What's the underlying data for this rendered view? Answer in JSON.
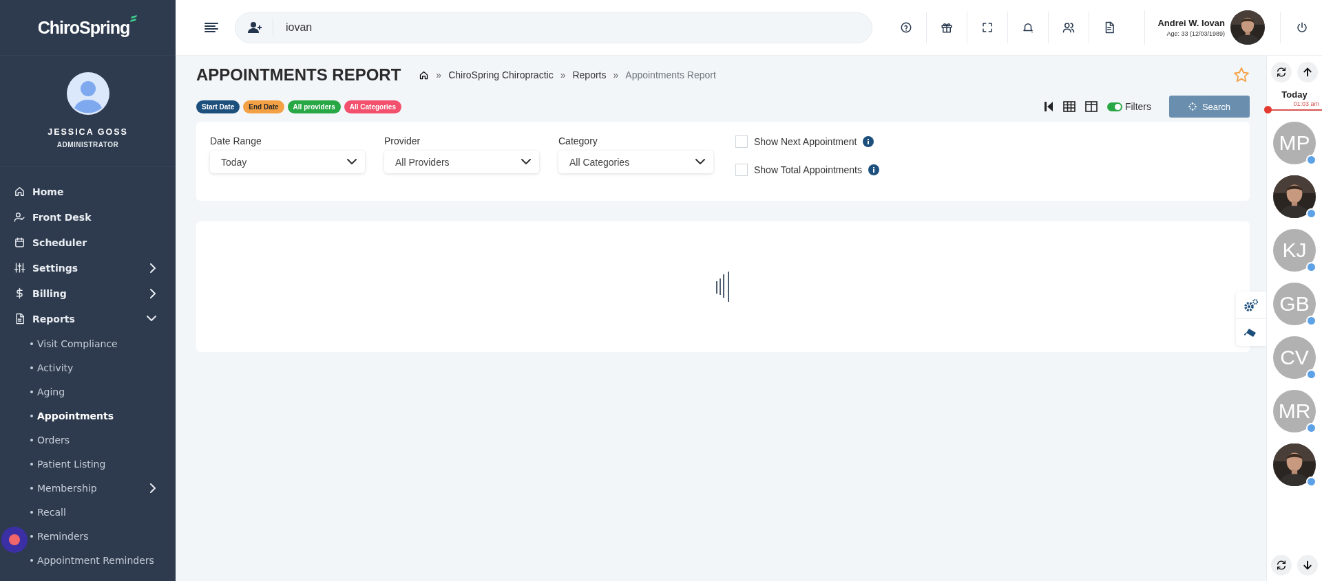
{
  "sidebar": {
    "logo": "ChiroSpring",
    "user": {
      "name": "JESSICA GOSS",
      "role": "ADMINISTRATOR"
    },
    "nav": [
      {
        "label": "Home"
      },
      {
        "label": "Front Desk"
      },
      {
        "label": "Scheduler"
      },
      {
        "label": "Settings",
        "expanded": false
      },
      {
        "label": "Billing",
        "expanded": false
      },
      {
        "label": "Reports",
        "expanded": true,
        "children": [
          {
            "label": "Visit Compliance",
            "selected": false
          },
          {
            "label": "Activity",
            "selected": false
          },
          {
            "label": "Aging",
            "selected": false
          },
          {
            "label": "Appointments",
            "selected": true
          },
          {
            "label": "Orders",
            "selected": false
          },
          {
            "label": "Patient Listing",
            "selected": false
          },
          {
            "label": "Membership",
            "selected": false,
            "expanded": false
          },
          {
            "label": "Recall",
            "selected": false
          },
          {
            "label": "Reminders",
            "selected": false
          },
          {
            "label": "Appointment Reminders",
            "selected": false
          }
        ]
      }
    ]
  },
  "topbar": {
    "search": {
      "value": "iovan"
    },
    "patient": {
      "name": "Andrei W. Iovan",
      "details": "Age: 33 (12/03/1989)"
    }
  },
  "page": {
    "title": "APPOINTMENTS REPORT",
    "breadcrumb": [
      {
        "kind": "separator",
        "text": "»"
      },
      {
        "kind": "link",
        "text": "ChiroSpring Chiropractic"
      },
      {
        "kind": "separator",
        "text": "»"
      },
      {
        "kind": "link",
        "text": "Reports"
      },
      {
        "kind": "separator",
        "text": "»"
      },
      {
        "kind": "current",
        "text": "Appointments Report"
      }
    ],
    "favorite": false,
    "chips": [
      {
        "label": "Start Date",
        "color": "#1d4f7c"
      },
      {
        "label": "End Date",
        "color": "#f4a145"
      },
      {
        "label": "All providers",
        "color": "#28a745"
      },
      {
        "label": "All Categories",
        "color": "#f2506d"
      }
    ],
    "toolbar": {
      "filters_label": "Filters",
      "filters_on": true,
      "search_label": "Search"
    },
    "filters": {
      "selects": [
        {
          "label": "Date Range",
          "value": "Today"
        },
        {
          "label": "Provider",
          "value": "All Providers"
        },
        {
          "label": "Category",
          "value": "All Categories"
        }
      ],
      "checkboxes": [
        {
          "label": "Show Next Appointment",
          "checked": false
        },
        {
          "label": "Show Total Appointments",
          "checked": false
        }
      ]
    }
  },
  "rail": {
    "day": "Today",
    "time": "01:03 am",
    "staff": [
      {
        "kind": "initials",
        "initials": "MP",
        "online": true
      },
      {
        "kind": "picture",
        "online": true
      },
      {
        "kind": "initials",
        "initials": "KJ",
        "online": true
      },
      {
        "kind": "initials",
        "initials": "GB",
        "online": true
      },
      {
        "kind": "initials",
        "initials": "CV",
        "online": true
      },
      {
        "kind": "initials",
        "initials": "MR",
        "online": true
      },
      {
        "kind": "picture",
        "online": true
      }
    ]
  }
}
